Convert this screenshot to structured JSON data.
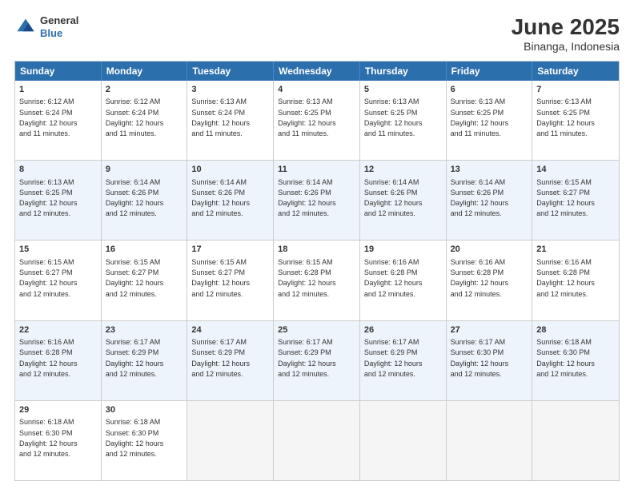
{
  "logo": {
    "general": "General",
    "blue": "Blue"
  },
  "header": {
    "title": "June 2025",
    "subtitle": "Binanga, Indonesia"
  },
  "weekdays": [
    "Sunday",
    "Monday",
    "Tuesday",
    "Wednesday",
    "Thursday",
    "Friday",
    "Saturday"
  ],
  "rows": [
    [
      {
        "day": "1",
        "info": "Sunrise: 6:12 AM\nSunset: 6:24 PM\nDaylight: 12 hours\nand 11 minutes."
      },
      {
        "day": "2",
        "info": "Sunrise: 6:12 AM\nSunset: 6:24 PM\nDaylight: 12 hours\nand 11 minutes."
      },
      {
        "day": "3",
        "info": "Sunrise: 6:13 AM\nSunset: 6:24 PM\nDaylight: 12 hours\nand 11 minutes."
      },
      {
        "day": "4",
        "info": "Sunrise: 6:13 AM\nSunset: 6:25 PM\nDaylight: 12 hours\nand 11 minutes."
      },
      {
        "day": "5",
        "info": "Sunrise: 6:13 AM\nSunset: 6:25 PM\nDaylight: 12 hours\nand 11 minutes."
      },
      {
        "day": "6",
        "info": "Sunrise: 6:13 AM\nSunset: 6:25 PM\nDaylight: 12 hours\nand 11 minutes."
      },
      {
        "day": "7",
        "info": "Sunrise: 6:13 AM\nSunset: 6:25 PM\nDaylight: 12 hours\nand 11 minutes."
      }
    ],
    [
      {
        "day": "8",
        "info": "Sunrise: 6:13 AM\nSunset: 6:25 PM\nDaylight: 12 hours\nand 12 minutes."
      },
      {
        "day": "9",
        "info": "Sunrise: 6:14 AM\nSunset: 6:26 PM\nDaylight: 12 hours\nand 12 minutes."
      },
      {
        "day": "10",
        "info": "Sunrise: 6:14 AM\nSunset: 6:26 PM\nDaylight: 12 hours\nand 12 minutes."
      },
      {
        "day": "11",
        "info": "Sunrise: 6:14 AM\nSunset: 6:26 PM\nDaylight: 12 hours\nand 12 minutes."
      },
      {
        "day": "12",
        "info": "Sunrise: 6:14 AM\nSunset: 6:26 PM\nDaylight: 12 hours\nand 12 minutes."
      },
      {
        "day": "13",
        "info": "Sunrise: 6:14 AM\nSunset: 6:26 PM\nDaylight: 12 hours\nand 12 minutes."
      },
      {
        "day": "14",
        "info": "Sunrise: 6:15 AM\nSunset: 6:27 PM\nDaylight: 12 hours\nand 12 minutes."
      }
    ],
    [
      {
        "day": "15",
        "info": "Sunrise: 6:15 AM\nSunset: 6:27 PM\nDaylight: 12 hours\nand 12 minutes."
      },
      {
        "day": "16",
        "info": "Sunrise: 6:15 AM\nSunset: 6:27 PM\nDaylight: 12 hours\nand 12 minutes."
      },
      {
        "day": "17",
        "info": "Sunrise: 6:15 AM\nSunset: 6:27 PM\nDaylight: 12 hours\nand 12 minutes."
      },
      {
        "day": "18",
        "info": "Sunrise: 6:15 AM\nSunset: 6:28 PM\nDaylight: 12 hours\nand 12 minutes."
      },
      {
        "day": "19",
        "info": "Sunrise: 6:16 AM\nSunset: 6:28 PM\nDaylight: 12 hours\nand 12 minutes."
      },
      {
        "day": "20",
        "info": "Sunrise: 6:16 AM\nSunset: 6:28 PM\nDaylight: 12 hours\nand 12 minutes."
      },
      {
        "day": "21",
        "info": "Sunrise: 6:16 AM\nSunset: 6:28 PM\nDaylight: 12 hours\nand 12 minutes."
      }
    ],
    [
      {
        "day": "22",
        "info": "Sunrise: 6:16 AM\nSunset: 6:28 PM\nDaylight: 12 hours\nand 12 minutes."
      },
      {
        "day": "23",
        "info": "Sunrise: 6:17 AM\nSunset: 6:29 PM\nDaylight: 12 hours\nand 12 minutes."
      },
      {
        "day": "24",
        "info": "Sunrise: 6:17 AM\nSunset: 6:29 PM\nDaylight: 12 hours\nand 12 minutes."
      },
      {
        "day": "25",
        "info": "Sunrise: 6:17 AM\nSunset: 6:29 PM\nDaylight: 12 hours\nand 12 minutes."
      },
      {
        "day": "26",
        "info": "Sunrise: 6:17 AM\nSunset: 6:29 PM\nDaylight: 12 hours\nand 12 minutes."
      },
      {
        "day": "27",
        "info": "Sunrise: 6:17 AM\nSunset: 6:30 PM\nDaylight: 12 hours\nand 12 minutes."
      },
      {
        "day": "28",
        "info": "Sunrise: 6:18 AM\nSunset: 6:30 PM\nDaylight: 12 hours\nand 12 minutes."
      }
    ],
    [
      {
        "day": "29",
        "info": "Sunrise: 6:18 AM\nSunset: 6:30 PM\nDaylight: 12 hours\nand 12 minutes."
      },
      {
        "day": "30",
        "info": "Sunrise: 6:18 AM\nSunset: 6:30 PM\nDaylight: 12 hours\nand 12 minutes."
      },
      {
        "day": "",
        "info": ""
      },
      {
        "day": "",
        "info": ""
      },
      {
        "day": "",
        "info": ""
      },
      {
        "day": "",
        "info": ""
      },
      {
        "day": "",
        "info": ""
      }
    ]
  ]
}
